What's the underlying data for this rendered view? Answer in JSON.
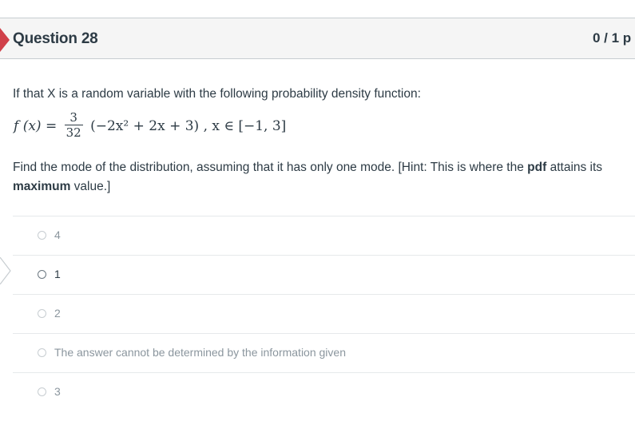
{
  "question": {
    "title": "Question 28",
    "points": "0 / 1 p"
  },
  "prompt": {
    "intro": "If that X is a random variable with the following probability density function:",
    "formula": {
      "lhs": "f (x) =",
      "numerator": "3",
      "denominator": "32",
      "body": "(−2x² + 2x + 3) , x ∈ [−1, 3]"
    },
    "instruction_part1": "Find the mode of the distribution, assuming that it has only one mode. [Hint: This is where the ",
    "instruction_bold1": "pdf",
    "instruction_part2": " attains its ",
    "instruction_bold2": "maximum",
    "instruction_part3": " value.]"
  },
  "answers": [
    {
      "label": "4",
      "selected": false
    },
    {
      "label": "1",
      "selected": true
    },
    {
      "label": "2",
      "selected": false
    },
    {
      "label": "The answer cannot be determined by the information given",
      "selected": false
    },
    {
      "label": "3",
      "selected": false
    }
  ],
  "colors": {
    "incorrect_marker": "#d0404a",
    "text": "#2d3b45",
    "muted_text": "#8b969e",
    "header_bg": "#f5f5f5",
    "divider": "#e6e9eb"
  }
}
